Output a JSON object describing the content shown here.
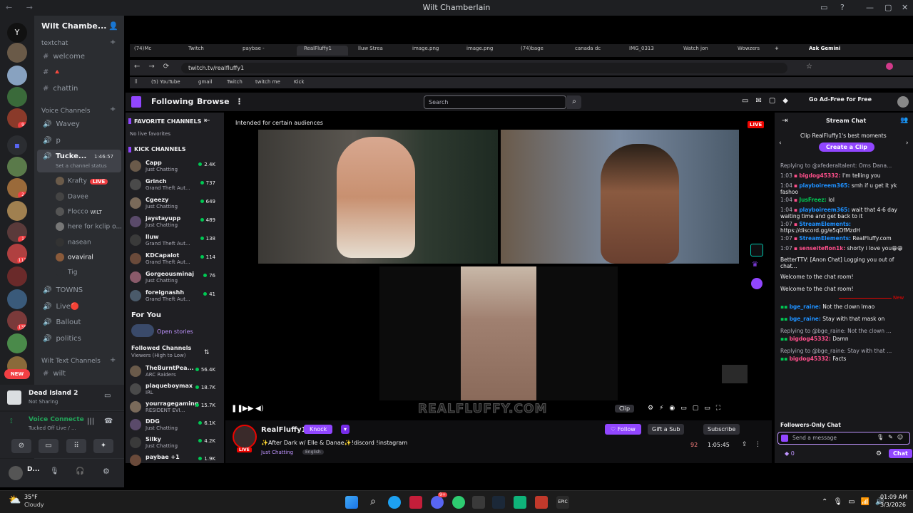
{
  "window": {
    "title": "Wilt Chamberlain"
  },
  "server": {
    "name": "Wilt Chambe...",
    "text_category": "textchat",
    "text_channels": [
      "welcome",
      "🔺",
      "chattin"
    ],
    "voice_category": "Voice Channels",
    "voice_channels": [
      "Wavey",
      "p"
    ],
    "active_voice": {
      "name": "Tucke...",
      "timer": "1:46:57",
      "status": "Set a channel status"
    },
    "voice_users": [
      {
        "name": "Krafty",
        "badge": "LIVE"
      },
      {
        "name": "Davee"
      },
      {
        "name": "Flocco",
        "badge": "WILT"
      },
      {
        "name": "here for kclip o..."
      },
      {
        "name": "nasean"
      },
      {
        "name": "ovaviral"
      },
      {
        "name": "Tig"
      }
    ],
    "more_voice": [
      "TOWNS",
      "Live🔴",
      "Ballout",
      "politics"
    ],
    "wilt_text_category": "Wilt Text Channels",
    "wilt_text": [
      "wilt"
    ]
  },
  "rail_badges": [
    "9",
    "2",
    "1",
    "112",
    "135",
    "3"
  ],
  "rail_new": "NEW",
  "game_panel": {
    "title": "Dead Island 2",
    "sub": "Not Sharing"
  },
  "voice_panel": {
    "title": "Voice Connecte",
    "sub": "Tucked Off Live / ..."
  },
  "user_panel": {
    "name": "D..."
  },
  "browser": {
    "tabs": [
      "(74)Mc",
      "Twitch",
      "paybae - ",
      "RealFluffy1",
      "lluw Strea",
      "image.png",
      "image.png",
      "(74)bage",
      "canada dc",
      "IMG_0313",
      "Watch jon",
      "Wowzers",
      "Ask Gemini"
    ],
    "url": "twitch.tv/realfluffy1",
    "bookmarks": [
      "(5) YouTube",
      "gmail",
      "Twitch",
      "twitch me",
      "Kick"
    ]
  },
  "twitch": {
    "nav": {
      "following": "Following",
      "browse": "Browse",
      "more": "⋮"
    },
    "search_placeholder": "Search",
    "adfree": "Go Ad-Free for Free",
    "side": {
      "favorite_header": "FAVORITE CHANNELS",
      "no_live": "No live favorites",
      "kick_header": "KICK CHANNELS",
      "kick": [
        {
          "name": "Capp",
          "game": "Just Chatting",
          "viewers": "2.4K"
        },
        {
          "name": "Grinch",
          "game": "Grand Theft Aut...",
          "viewers": "737"
        },
        {
          "name": "Cgeezy",
          "game": "Just Chatting",
          "viewers": "649"
        },
        {
          "name": "jaystayupp",
          "game": "Just Chatting",
          "viewers": "489"
        },
        {
          "name": "lluw",
          "game": "Grand Theft Aut...",
          "viewers": "138"
        },
        {
          "name": "KDCapalot",
          "game": "Grand Theft Aut...",
          "viewers": "114"
        },
        {
          "name": "Gorgeousminaj",
          "game": "Just Chatting",
          "viewers": "76"
        },
        {
          "name": "foreignashh",
          "game": "Grand Theft Aut...",
          "viewers": "41"
        }
      ],
      "for_you": "For You",
      "open_stories": "Open stories",
      "followed_header": "Followed Channels",
      "followed_sub": "Viewers (High to Low)",
      "followed": [
        {
          "name": "TheBurntPea...",
          "game": "ARC Raiders",
          "viewers": "56.4K"
        },
        {
          "name": "plaqueboymax",
          "game": "IRL",
          "viewers": "18.7K"
        },
        {
          "name": "yourragegaming",
          "game": "RESIDENT EVI...",
          "viewers": "15.7K"
        },
        {
          "name": "DDG",
          "game": "Just Chatting",
          "viewers": "6.1K"
        },
        {
          "name": "Silky",
          "game": "Just Chatting",
          "viewers": "4.2K"
        },
        {
          "name": "paybae +1",
          "game": "",
          "viewers": "1.9K"
        }
      ]
    },
    "player": {
      "audience": "Intended for certain audiences",
      "live": "LIVE",
      "watermark": "REALFLUFFY.COM",
      "clip": "Clip"
    },
    "info": {
      "channel": "RealFluffy1",
      "knock": "Knock",
      "title": "✨After Dark w/ Elle & Danae✨!discord !instagram",
      "category": "Just Chatting",
      "lang": "English",
      "follow": "Follow",
      "gift": "Gift a Sub",
      "subscribe": "Subscribe",
      "viewers": "92",
      "uptime": "1:05:45",
      "live": "LIVE"
    },
    "chat": {
      "header": "Stream Chat",
      "clip_prompt": "Clip RealFluffy1's best moments",
      "create_clip": "Create a Clip",
      "messages": [
        {
          "time": "",
          "user": "",
          "text": "Replying to @xfederaltalent: Oms Dana...",
          "color": "#adadb8"
        },
        {
          "time": "1:03",
          "user": "bigdog45332:",
          "text": "I'm telling you",
          "color": "#ff4f8b"
        },
        {
          "time": "1:04",
          "user": "playboireem365:",
          "text": "smh if u get it yk fashoo",
          "color": "#1e90ff"
        },
        {
          "time": "1:04",
          "user": "JusFreez:",
          "text": "lol",
          "color": "#00c853"
        },
        {
          "time": "1:04",
          "user": "playboireem365:",
          "text": "wait that 4-6 day waiting time and get back to it",
          "color": "#1e90ff"
        },
        {
          "time": "1:07",
          "user": "StreamElements:",
          "text": "https://discord.gg/e5qDfMzdH",
          "color": "#1e90ff"
        },
        {
          "time": "1:07",
          "user": "StreamElements:",
          "text": "RealFluffy.com",
          "color": "#1e90ff"
        },
        {
          "time": "1:07",
          "user": "senseiteflon1k:",
          "text": "shorty i love you😁😁",
          "color": "#ff4f8b"
        }
      ],
      "system": [
        "BetterTTV: [Anon Chat] Logging you out of chat...",
        "Welcome to the chat room!",
        "Welcome to the chat room!"
      ],
      "new_label": "New",
      "after": [
        {
          "user": "bge_raine:",
          "text": "Not the clown lmao",
          "color": "#1e90ff"
        },
        {
          "user": "bge_raine:",
          "text": "Stay with that mask on",
          "color": "#1e90ff"
        },
        {
          "reply": "Replying to @bge_raine: Not the clown ...",
          "user": "bigdog45332:",
          "text": "Damn",
          "color": "#ff4f8b"
        },
        {
          "reply": "Replying to @bge_raine: Stay with that ...",
          "user": "bigdog45332:",
          "text": "Facts",
          "color": "#ff4f8b"
        }
      ],
      "followers_only": "Followers-Only Chat",
      "input_placeholder": "Send a message",
      "points": "0",
      "chat_btn": "Chat"
    }
  },
  "taskbar": {
    "weather_temp": "35°F",
    "weather_desc": "Cloudy",
    "time": "01:09 AM",
    "date": "3/3/2026",
    "badge": "9+"
  }
}
